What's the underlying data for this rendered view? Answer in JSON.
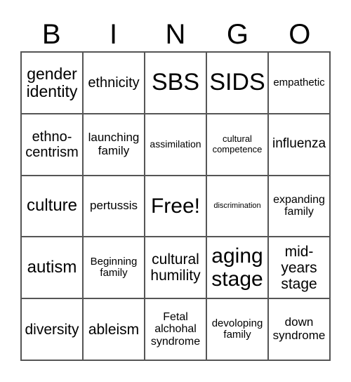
{
  "title": "BINGO",
  "header": [
    "B",
    "I",
    "N",
    "G",
    "O"
  ],
  "cells": [
    {
      "text": "gender identity",
      "size": 23
    },
    {
      "text": "ethnicity",
      "size": 20
    },
    {
      "text": "SBS",
      "size": 34
    },
    {
      "text": "SIDS",
      "size": 34
    },
    {
      "text": "empathetic",
      "size": 15
    },
    {
      "text": "ethno- centrism",
      "size": 20
    },
    {
      "text": "launching family",
      "size": 17
    },
    {
      "text": "assimilation",
      "size": 14
    },
    {
      "text": "cultural competence",
      "size": 13
    },
    {
      "text": "influenza",
      "size": 19
    },
    {
      "text": "culture",
      "size": 24
    },
    {
      "text": "pertussis",
      "size": 17
    },
    {
      "text": "Free!",
      "size": 30
    },
    {
      "text": "discrimination",
      "size": 11
    },
    {
      "text": "expanding family",
      "size": 16
    },
    {
      "text": "autism",
      "size": 24
    },
    {
      "text": "Beginning family",
      "size": 15
    },
    {
      "text": "cultural humility",
      "size": 21
    },
    {
      "text": "aging stage",
      "size": 30
    },
    {
      "text": "mid- years stage",
      "size": 21
    },
    {
      "text": "diversity",
      "size": 21
    },
    {
      "text": "ableism",
      "size": 21
    },
    {
      "text": "Fetal alchohal syndrome",
      "size": 16
    },
    {
      "text": "devoloping family",
      "size": 15
    },
    {
      "text": "down syndrome",
      "size": 17
    }
  ]
}
